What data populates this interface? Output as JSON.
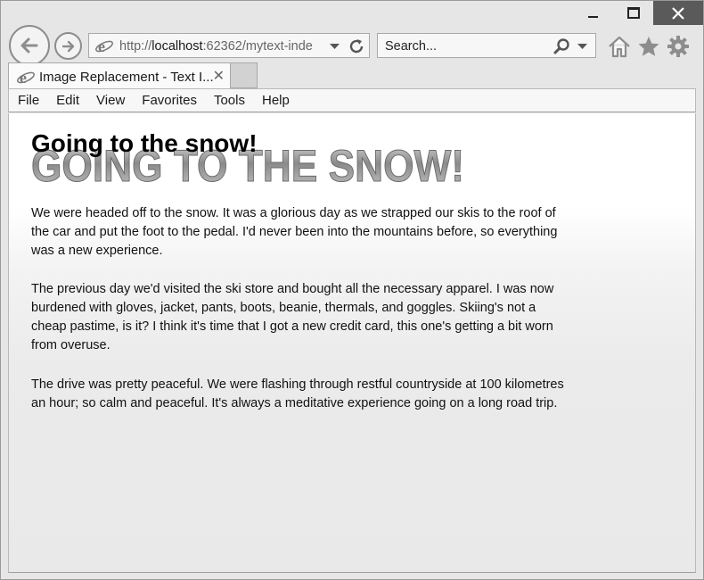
{
  "browser": {
    "address_url_prefix": "http://",
    "address_url_host": "localhost",
    "address_url_rest": ":62362/mytext-inde",
    "search_placeholder": "Search...",
    "tab_title": "Image Replacement - Text I...",
    "tab_close_glyph": "✕"
  },
  "menu": [
    "File",
    "Edit",
    "View",
    "Favorites",
    "Tools",
    "Help"
  ],
  "page": {
    "heading": "Going to the snow!",
    "heading_image_text": "GOING TO THE SNOW!",
    "paragraphs": [
      "We were headed off to the snow. It was a glorious day as we strapped our skis to the roof of the car and put the foot to the pedal. I'd never been into the mountains before, so everything was a new experience.",
      "The previous day we'd visited the ski store and bought all the necessary apparel. I was now burdened with gloves, jacket, pants, boots, beanie, thermals, and goggles. Skiing's not a cheap pastime, is it? I think it's time that I got a new credit card, this one's getting a bit worn from overuse.",
      "The drive was pretty peaceful. We were flashing through restful countryside at 100 kilometres an hour; so calm and peaceful. It's always a meditative experience going on a long road trip."
    ]
  },
  "icons": {
    "back": "back-arrow-icon",
    "forward": "forward-arrow-icon",
    "ie_logo": "ie-logo-icon",
    "refresh": "refresh-icon",
    "search": "magnifier-icon",
    "home": "home-icon",
    "favorites": "star-icon",
    "settings": "gear-icon"
  },
  "colors": {
    "close_button": "#5a5a5a",
    "ie_logo": "#7a7a7a"
  }
}
